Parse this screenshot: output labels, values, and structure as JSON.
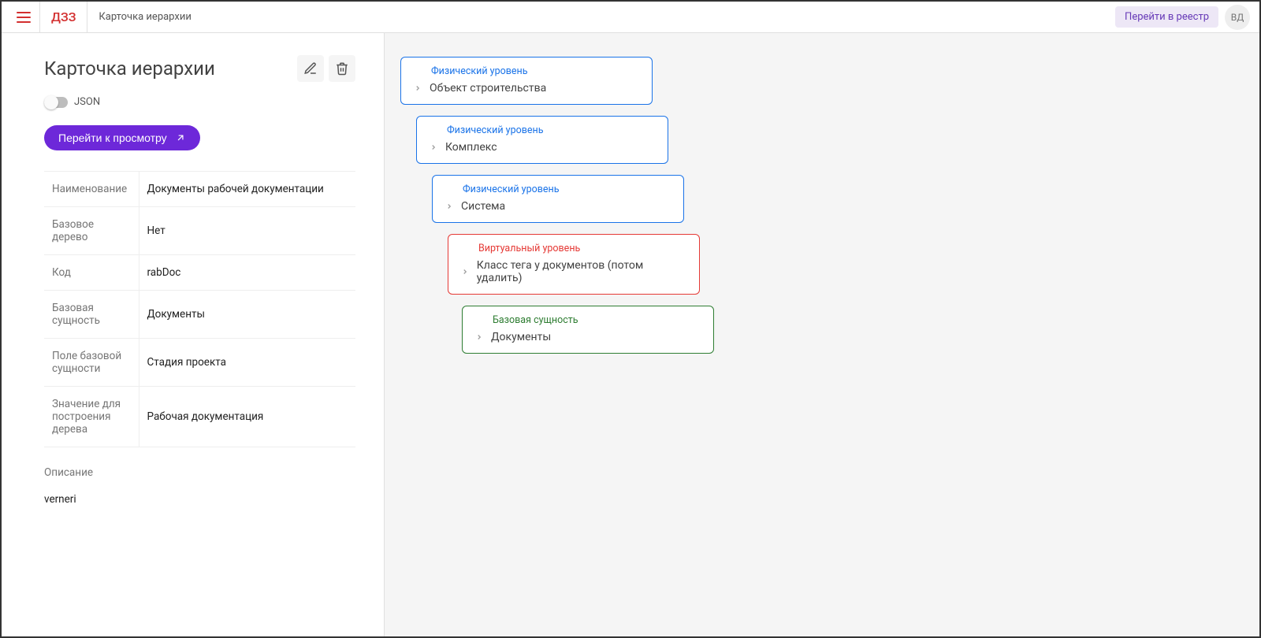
{
  "header": {
    "logo": "ДЗЗ",
    "breadcrumb": "Карточка иерархии",
    "registryButton": "Перейти в реестр",
    "avatar": "ВД"
  },
  "page": {
    "title": "Карточка иерархии",
    "jsonToggleLabel": "JSON",
    "viewButton": "Перейти к просмотру"
  },
  "properties": {
    "rows": [
      {
        "label": "Наименование",
        "value": "Документы рабочей документации"
      },
      {
        "label": "Базовое дерево",
        "value": "Нет"
      },
      {
        "label": "Код",
        "value": "rabDoc"
      },
      {
        "label": "Базовая сущность",
        "value": "Документы"
      },
      {
        "label": "Поле базовой сущности",
        "value": "Стадия проекта"
      },
      {
        "label": "Значение для построения дерева",
        "value": "Рабочая документация"
      }
    ],
    "descriptionLabel": "Описание",
    "descriptionValue": "verneri"
  },
  "tree": {
    "typeLabels": {
      "physical": "Физический уровень",
      "virtual": "Виртуальный уровень",
      "base": "Базовая сущность"
    },
    "nodes": [
      {
        "type": "physical",
        "title": "Объект строительства",
        "indent": 0
      },
      {
        "type": "physical",
        "title": "Комплекс",
        "indent": 1
      },
      {
        "type": "physical",
        "title": "Система",
        "indent": 2
      },
      {
        "type": "virtual",
        "title": "Класс тега у документов (потом удалить)",
        "indent": 3
      },
      {
        "type": "base",
        "title": "Документы",
        "indent": 4
      }
    ]
  }
}
